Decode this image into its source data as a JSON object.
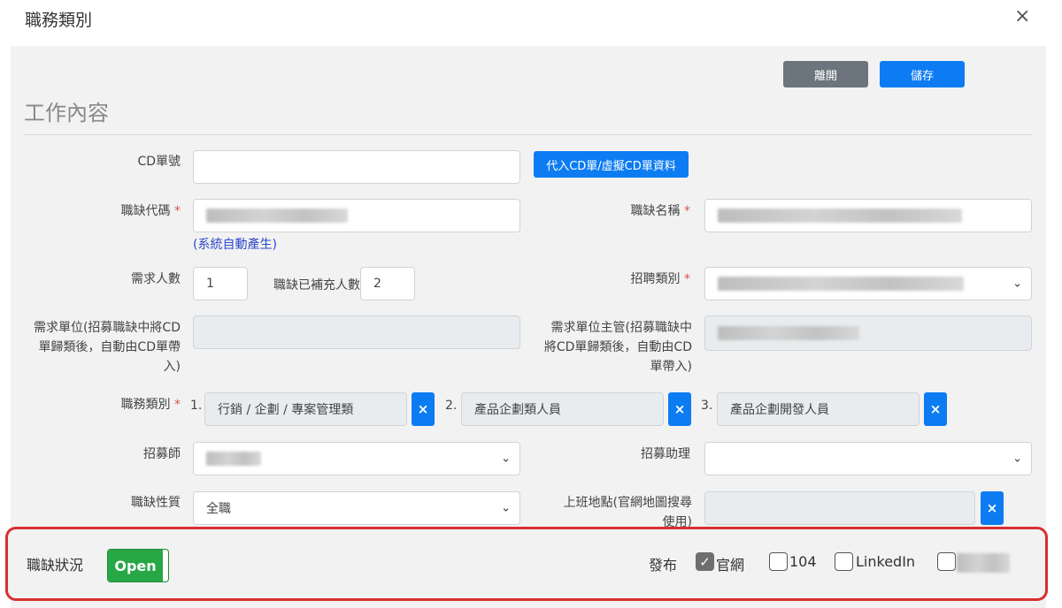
{
  "modal": {
    "title": "職務類別",
    "close_glyph": "×"
  },
  "toolbar": {
    "leave_label": "離開",
    "save_label": "儲存"
  },
  "section": {
    "title": "工作內容"
  },
  "form": {
    "cd_number": {
      "label": "CD單號",
      "value": "",
      "import_button": "代入CD單/虛擬CD單資料"
    },
    "job_code": {
      "label": "職缺代碼",
      "required": "*",
      "note": "(系統自動產生)"
    },
    "job_name": {
      "label": "職缺名稱",
      "required": "*"
    },
    "headcount": {
      "label": "需求人數",
      "value": "1"
    },
    "filled": {
      "label": "職缺已補充人數",
      "value": "2"
    },
    "recruit_type": {
      "label": "招聘類別",
      "required": "*"
    },
    "request_unit": {
      "label": "需求單位(招募職缺中將CD單歸類後，自動由CD單帶入)"
    },
    "request_manager": {
      "label": "需求單位主管(招募職缺中將CD單歸類後，自動由CD單帶入)"
    },
    "job_category": {
      "label": "職務類別",
      "required": "*",
      "items": [
        {
          "index": "1.",
          "value": "行銷 / 企劃 / 專案管理類"
        },
        {
          "index": "2.",
          "value": "產品企劃類人員"
        },
        {
          "index": "3.",
          "value": "產品企劃開發人員"
        }
      ],
      "remove_glyph": "×"
    },
    "recruiter": {
      "label": "招募師"
    },
    "recruit_assistant": {
      "label": "招募助理"
    },
    "job_nature": {
      "label": "職缺性質",
      "value": "全職"
    },
    "work_location": {
      "label": "上班地點(官網地圖搜尋使用)"
    },
    "chevron_glyph": "⌄"
  },
  "status_bar": {
    "label": "職缺狀況",
    "toggle_label": "Open",
    "toggle_on": true,
    "publish_label": "發布",
    "channels": [
      {
        "label": "官網",
        "checked": true
      },
      {
        "label": "104",
        "checked": false
      },
      {
        "label": "LinkedIn",
        "checked": false
      },
      {
        "label": "",
        "checked": false
      }
    ],
    "check_glyph": "✓"
  },
  "colors": {
    "primary": "#0d7cf2",
    "secondary": "#6c757d",
    "success": "#28a745",
    "highlight_border": "#d83030"
  }
}
